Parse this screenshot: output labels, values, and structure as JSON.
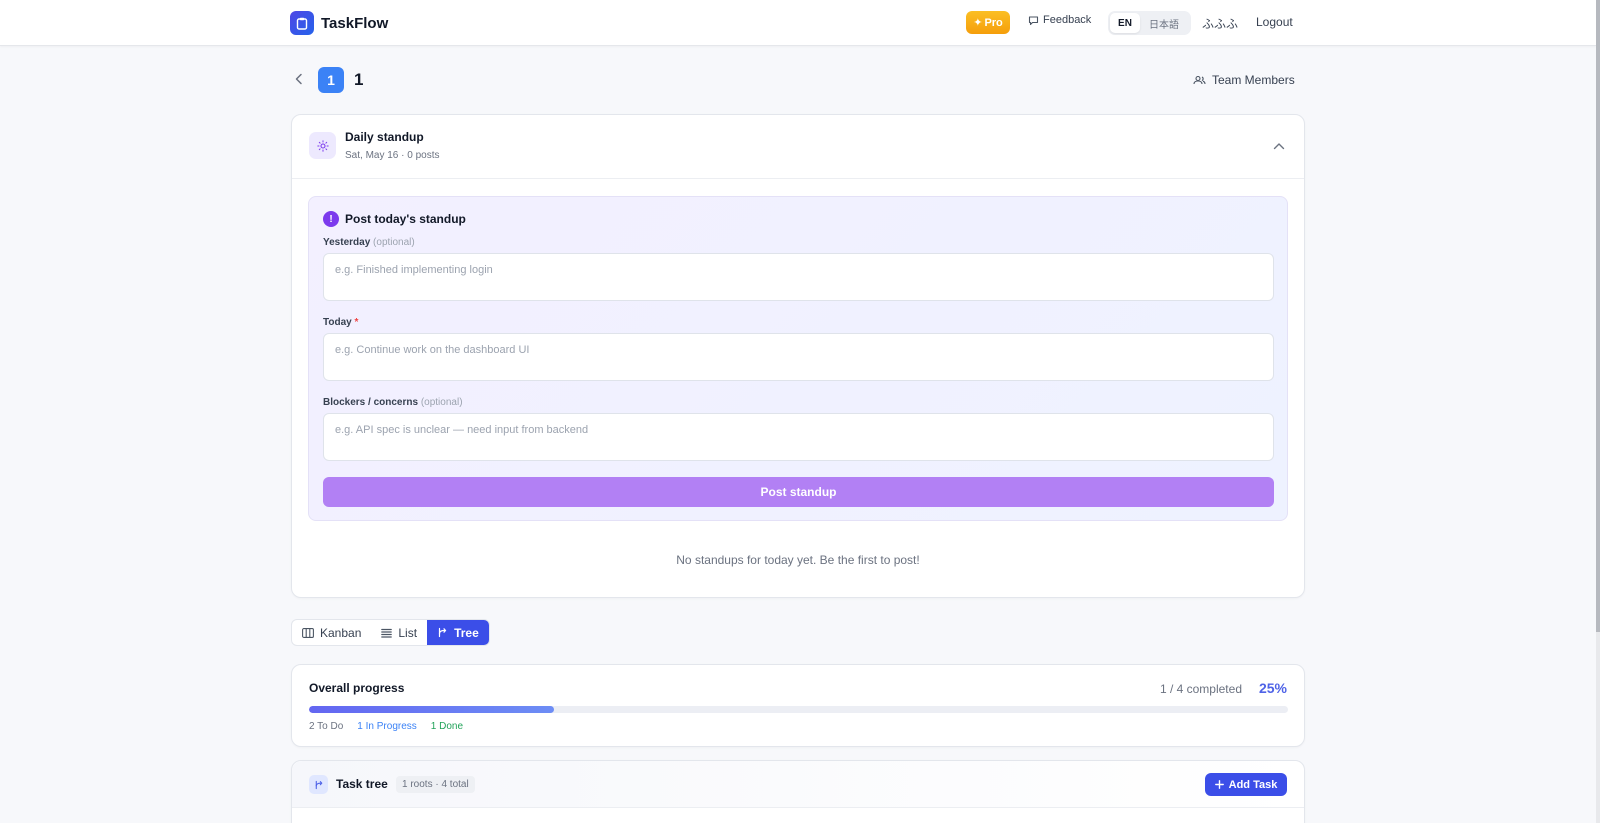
{
  "header": {
    "brand": "TaskFlow",
    "pro_label": "Pro",
    "feedback_label": "Feedback",
    "lang_en": "EN",
    "lang_ja": "日本語",
    "user_name": "ふふふ",
    "logout_label": "Logout"
  },
  "project": {
    "badge": "1",
    "name": "1",
    "team_members_label": "Team Members"
  },
  "standup": {
    "title": "Daily standup",
    "subtitle": "Sat, May 16 · 0 posts",
    "post_title": "Post today's standup",
    "yesterday_label": "Yesterday",
    "yesterday_optional": "(optional)",
    "yesterday_placeholder": "e.g. Finished implementing login",
    "today_label": "Today",
    "today_required": "*",
    "today_placeholder": "e.g. Continue work on the dashboard UI",
    "blockers_label": "Blockers / concerns",
    "blockers_optional": "(optional)",
    "blockers_placeholder": "e.g. API spec is unclear — need input from backend",
    "post_button": "Post standup",
    "empty_message": "No standups for today yet. Be the first to post!"
  },
  "views": {
    "tabs": [
      {
        "label": "Kanban",
        "icon": "columns-icon",
        "active": false
      },
      {
        "label": "List",
        "icon": "list-icon",
        "active": false
      },
      {
        "label": "Tree",
        "icon": "tree-icon",
        "active": true
      }
    ]
  },
  "progress": {
    "title": "Overall progress",
    "count": "1 / 4 completed",
    "percent_label": "25%",
    "fill_fraction": 0.25,
    "todo": "2 To Do",
    "in_progress": "1 In Progress",
    "done": "1 Done"
  },
  "tree": {
    "title": "Task tree",
    "stats": "1 roots · 4 total",
    "add_button": "Add Task"
  },
  "colors": {
    "accent": "#3b4ee8",
    "pro": "#f59e0b",
    "post_button": "#b280f4",
    "in_progress": "#3b82f6",
    "done": "#22a35a"
  }
}
